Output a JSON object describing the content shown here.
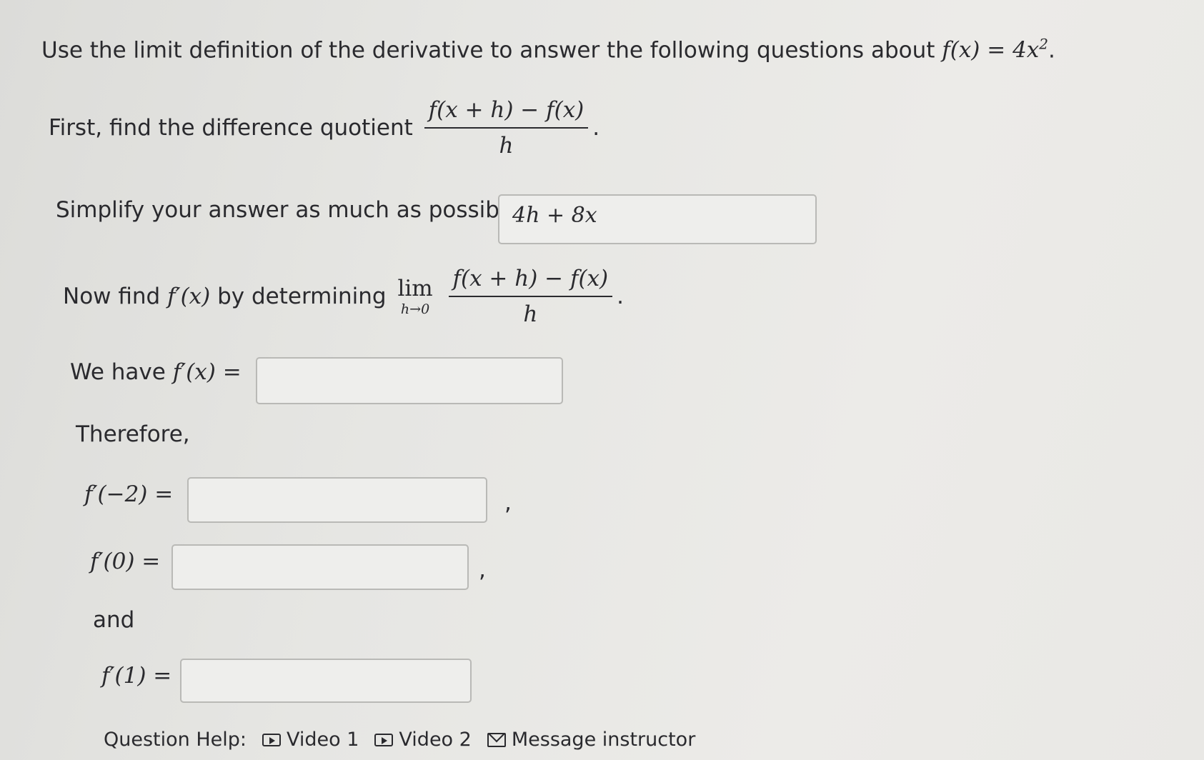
{
  "intro": {
    "text": "Use the limit definition of the derivative to answer the following questions about",
    "function": "f(x) = 4x",
    "exponent": "2",
    "end": "."
  },
  "step1": {
    "text": "First, find the difference quotient",
    "numerator": "f(x + h) − f(x)",
    "denominator": "h",
    "end": "."
  },
  "simplify": {
    "label": "Simplify your answer as much as possible:",
    "value": "4h + 8x"
  },
  "step2": {
    "text_a": "Now find",
    "fprime": "f′(x)",
    "text_b": "by determining",
    "lim": "lim",
    "lim_sub": "h→0",
    "numerator": "f(x + h) − f(x)",
    "denominator": "h",
    "end": "."
  },
  "we_have": {
    "label": "We have",
    "expr": "f′(x) =",
    "value": ""
  },
  "therefore": "Therefore,",
  "eval": [
    {
      "expr": "f′(−2) =",
      "value": "",
      "suffix": ","
    },
    {
      "expr": "f′(0) =",
      "value": "",
      "suffix": ","
    },
    {
      "expr": "f′(1) =",
      "value": "",
      "suffix": ""
    }
  ],
  "and": "and",
  "help": {
    "label": "Question Help:",
    "video1": "Video 1",
    "video2": "Video 2",
    "message": "Message instructor"
  }
}
